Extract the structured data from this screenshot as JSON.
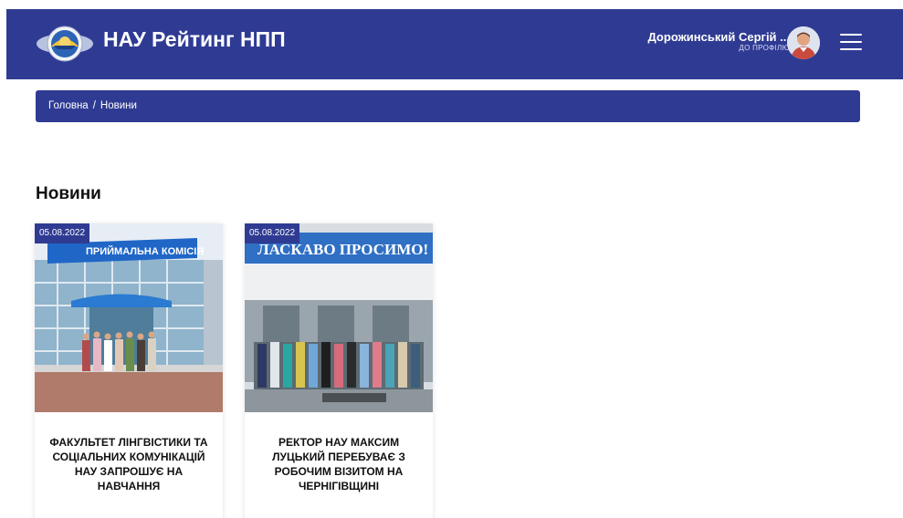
{
  "header": {
    "brand": "НАУ Рейтинг НПП",
    "user_name": "Дорожинський Сергій ...",
    "profile_link": "ДО ПРОФІЛЮ",
    "colors": {
      "primary": "#2f3b93",
      "text_on_primary": "#ffffff"
    },
    "icons": {
      "logo": "nau-emblem-icon",
      "avatar": "user-avatar",
      "menu": "hamburger-menu-icon"
    }
  },
  "breadcrumb": {
    "home": "Головна",
    "separator": "/",
    "current": "Новини"
  },
  "main": {
    "title": "Новини",
    "news": [
      {
        "date": "05.08.2022",
        "title": "ФАКУЛЬТЕТ ЛІНГВІСТИКИ ТА СОЦІАЛЬНИХ КОМУНІКАЦІЙ НАУ ЗАПРОШУЄ НА НАВЧАННЯ",
        "photo_sign": "ПРИЙМАЛЬНА КОМІСІЯ"
      },
      {
        "date": "05.08.2022",
        "title": "РЕКТОР НАУ МАКСИМ ЛУЦЬКИЙ ПЕРЕБУВАЄ З РОБОЧИМ ВІЗИТОМ НА ЧЕРНІГІВЩИНІ",
        "photo_sign": "ЛАСКАВО ПРОСИМО!"
      }
    ]
  }
}
